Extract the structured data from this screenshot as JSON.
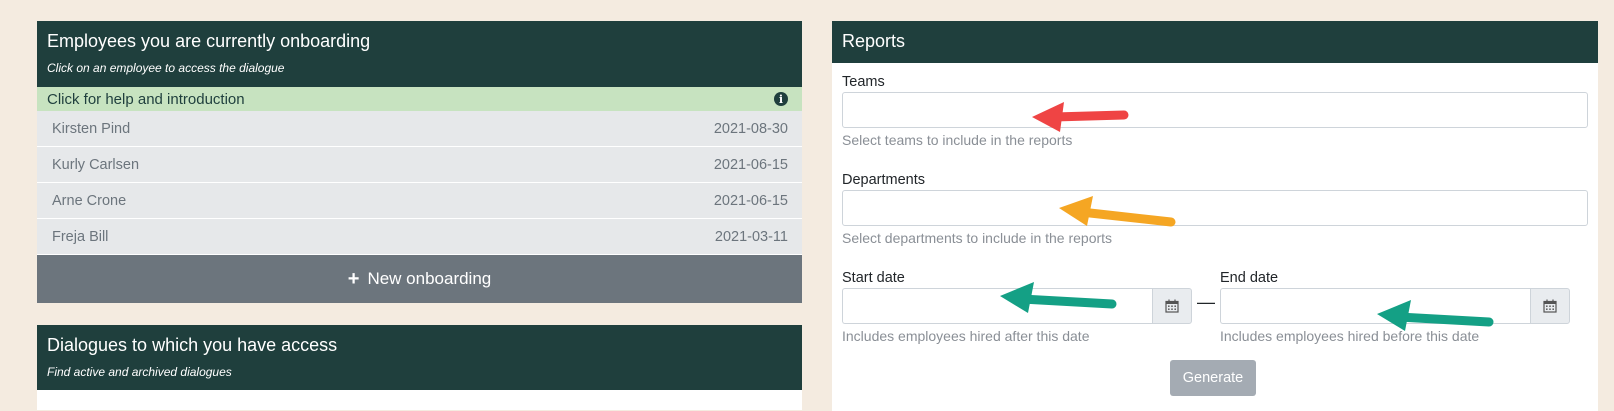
{
  "onboarding": {
    "title": "Employees you are currently onboarding",
    "subtitle": "Click on an employee to access the dialogue",
    "help_label": "Click for help and introduction",
    "employees": [
      {
        "name": "Kirsten Pind",
        "date": "2021-08-30"
      },
      {
        "name": "Kurly Carlsen",
        "date": "2021-06-15"
      },
      {
        "name": "Arne Crone",
        "date": "2021-06-15"
      },
      {
        "name": "Freja Bill",
        "date": "2021-03-11"
      }
    ],
    "new_button": "New onboarding"
  },
  "dialogues": {
    "title": "Dialogues to which you have access",
    "subtitle": "Find active and archived dialogues"
  },
  "reports": {
    "title": "Reports",
    "teams_label": "Teams",
    "teams_hint": "Select teams to include in the reports",
    "departments_label": "Departments",
    "departments_hint": "Select departments to include in the reports",
    "start_label": "Start date",
    "start_hint": "Includes employees hired after this date",
    "end_label": "End date",
    "end_hint": "Includes employees hired before this date",
    "range_separator": "—",
    "generate_button": "Generate"
  },
  "icons": {
    "info": "info-circle-icon",
    "plus": "plus-icon",
    "calendar": "calendar-icon",
    "annotation": "arrow-icon"
  },
  "colors": {
    "header": "#1f3f3d",
    "help_row": "#c7e3c0",
    "button_gray": "#6c757d",
    "arrow_red": "#ef4444",
    "arrow_orange": "#f5a623",
    "arrow_green": "#14a085"
  }
}
